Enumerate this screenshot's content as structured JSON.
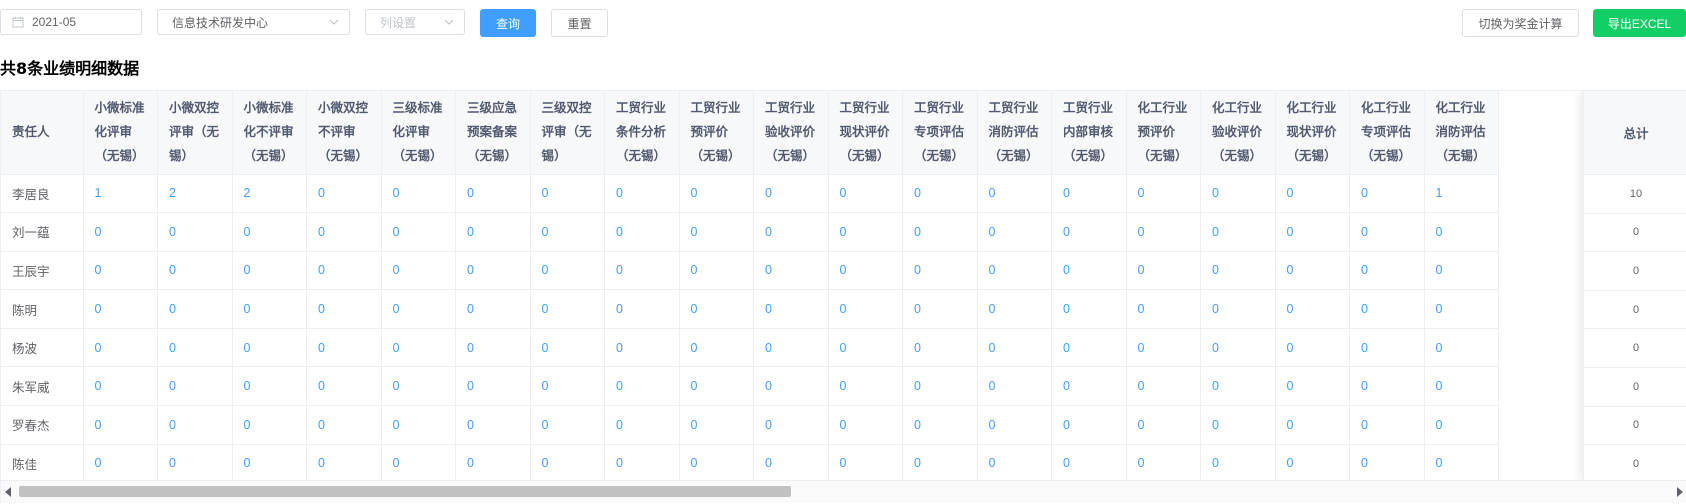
{
  "filters": {
    "date": "2021-05",
    "department": "信息技术研发中心",
    "column_settings_placeholder": "列设置"
  },
  "buttons": {
    "query": "查询",
    "reset": "重置",
    "switch_bonus": "切换为奖金计算",
    "export_excel": "导出EXCEL"
  },
  "summary_title": "共8条业绩明细数据",
  "table": {
    "name_header": "责任人",
    "total_header": "总计",
    "columns": [
      "小微标准化评审（无锡）",
      "小微双控评审（无锡）",
      "小微标准化不评审（无锡）",
      "小微双控不评审（无锡）",
      "三级标准化评审（无锡）",
      "三级应急预案备案（无锡）",
      "三级双控评审（无锡）",
      "工贸行业条件分析（无锡）",
      "工贸行业预评价（无锡）",
      "工贸行业验收评价（无锡）",
      "工贸行业现状评价（无锡）",
      "工贸行业专项评估（无锡）",
      "工贸行业消防评估（无锡）",
      "工贸行业内部审核（无锡）",
      "化工行业预评价（无锡）",
      "化工行业验收评价（无锡）",
      "化工行业现状评价（无锡）",
      "化工行业专项评估（无锡）",
      "化工行业消防评估（无锡）"
    ],
    "rows": [
      {
        "name": "李居良",
        "values": [
          1,
          2,
          2,
          0,
          0,
          0,
          0,
          0,
          0,
          0,
          0,
          0,
          0,
          0,
          0,
          0,
          0,
          0,
          1
        ],
        "total": 10
      },
      {
        "name": "刘一蕴",
        "values": [
          0,
          0,
          0,
          0,
          0,
          0,
          0,
          0,
          0,
          0,
          0,
          0,
          0,
          0,
          0,
          0,
          0,
          0,
          0
        ],
        "total": 0
      },
      {
        "name": "王辰宇",
        "values": [
          0,
          0,
          0,
          0,
          0,
          0,
          0,
          0,
          0,
          0,
          0,
          0,
          0,
          0,
          0,
          0,
          0,
          0,
          0
        ],
        "total": 0
      },
      {
        "name": "陈明",
        "values": [
          0,
          0,
          0,
          0,
          0,
          0,
          0,
          0,
          0,
          0,
          0,
          0,
          0,
          0,
          0,
          0,
          0,
          0,
          0
        ],
        "total": 0
      },
      {
        "name": "杨波",
        "values": [
          0,
          0,
          0,
          0,
          0,
          0,
          0,
          0,
          0,
          0,
          0,
          0,
          0,
          0,
          0,
          0,
          0,
          0,
          0
        ],
        "total": 0
      },
      {
        "name": "朱军威",
        "values": [
          0,
          0,
          0,
          0,
          0,
          0,
          0,
          0,
          0,
          0,
          0,
          0,
          0,
          0,
          0,
          0,
          0,
          0,
          0
        ],
        "total": 0
      },
      {
        "name": "罗春杰",
        "values": [
          0,
          0,
          0,
          0,
          0,
          0,
          0,
          0,
          0,
          0,
          0,
          0,
          0,
          0,
          0,
          0,
          0,
          0,
          0
        ],
        "total": 0
      },
      {
        "name": "陈佳",
        "values": [
          0,
          0,
          0,
          0,
          0,
          0,
          0,
          0,
          0,
          0,
          0,
          0,
          0,
          0,
          0,
          0,
          0,
          0,
          0
        ],
        "total": 0
      }
    ]
  },
  "icons": [
    "calendar-icon",
    "chevron-down-icon",
    "scroll-left-arrow-icon",
    "scroll-right-arrow-icon"
  ],
  "colors": {
    "primary": "#409eff",
    "success": "#13ce66"
  }
}
